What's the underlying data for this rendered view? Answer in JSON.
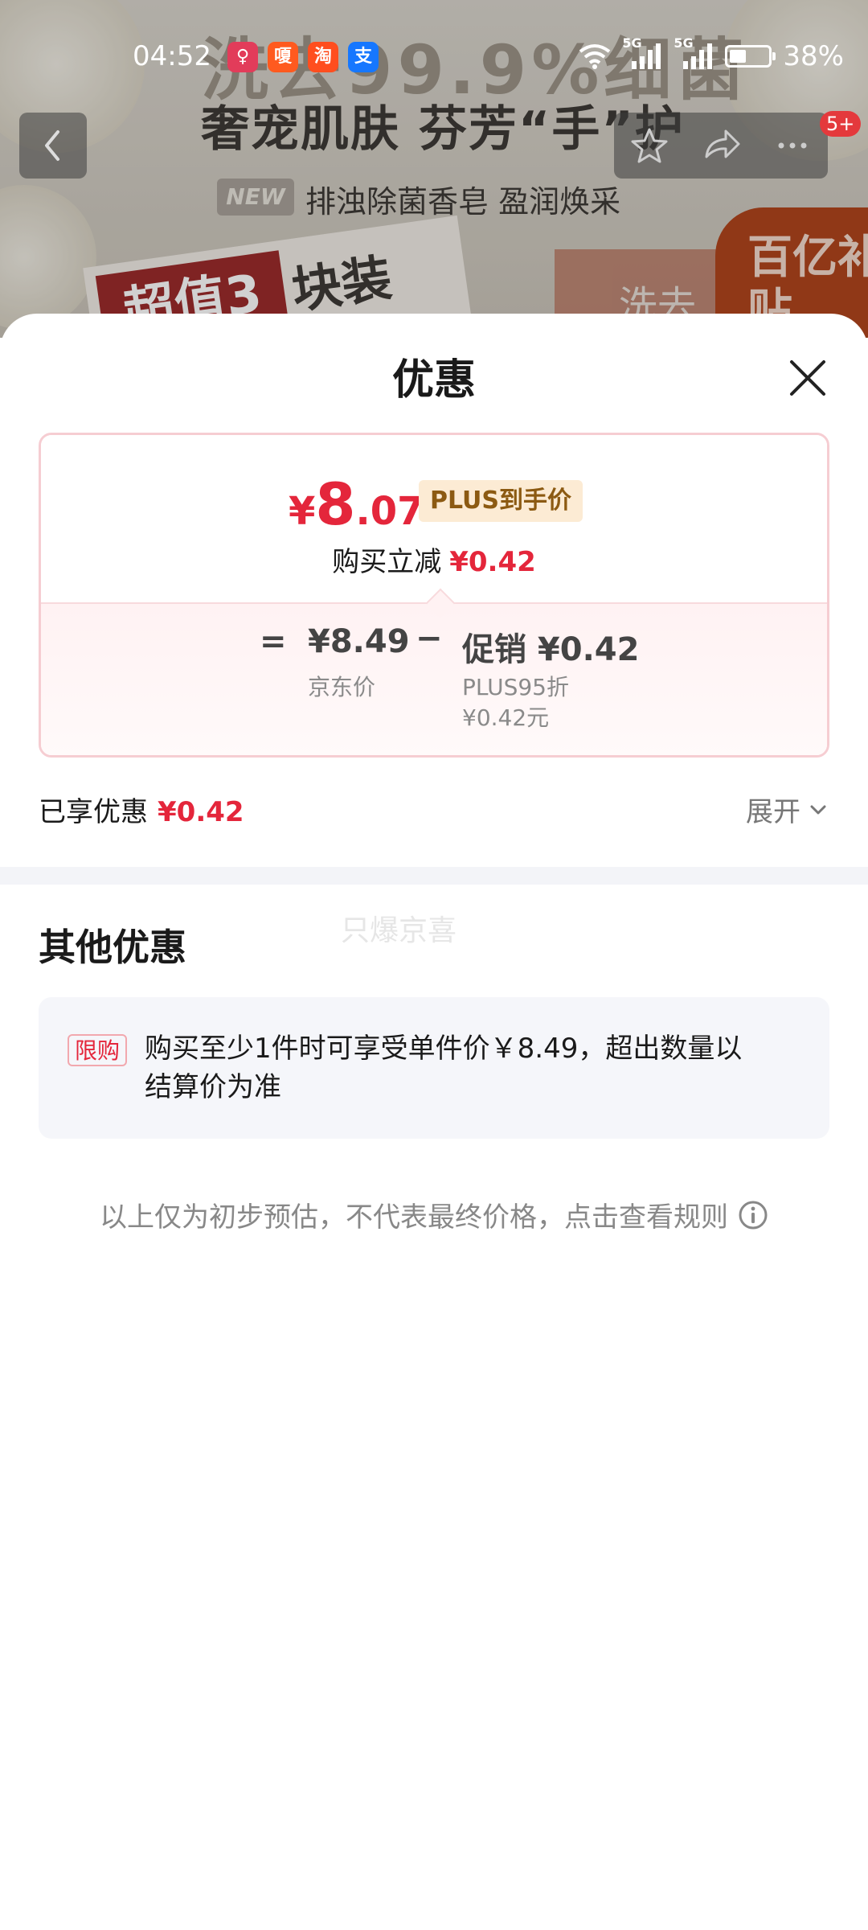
{
  "status_bar": {
    "time": "04:52",
    "app_icons": [
      {
        "name": "app-icon-1",
        "glyph": "♀",
        "color": "#e23c5a"
      },
      {
        "name": "app-icon-2",
        "glyph": "嗄",
        "color": "#ff5a1f"
      },
      {
        "name": "taobao-icon",
        "glyph": "淘",
        "color": "#ff4e1f"
      },
      {
        "name": "alipay-icon",
        "glyph": "支",
        "color": "#1677ff"
      }
    ],
    "signal1": "5G",
    "signal2": "5G",
    "battery": "38%"
  },
  "background": {
    "headline": "洗去99.9%细菌",
    "subheadline": "奢宠肌肤 芬芳“手”护",
    "new_tag": "NEW",
    "subline": "排浊除菌香皂 盈润焕采",
    "pack_red": "超值3",
    "pack_rest": "块装",
    "box_text": "洗去",
    "sticker": "百亿补贴"
  },
  "nav": {
    "badge": "5+"
  },
  "sheet": {
    "title": "优惠",
    "final_price": {
      "currency": "¥",
      "integer": "8",
      "decimal": ".07"
    },
    "plus_tag": "PLUS到手价",
    "reduce_label": "购买立减",
    "reduce_amount": "¥0.42",
    "breakdown": {
      "eq": "=",
      "base_price": "¥8.49",
      "base_label": "京东价",
      "minus": "−",
      "promo_price": "促销 ¥0.42",
      "promo_label": "PLUS95折",
      "promo_sub": "¥0.42元"
    },
    "enjoyed_label": "已享优惠",
    "enjoyed_amount": "¥0.42",
    "expand_label": "展开",
    "other_title": "其他优惠",
    "watermark": "只爆京喜",
    "limit_tag": "限购",
    "limit_text": "购买至少1件时可享受单件价￥8.49，超出数量以结算价为准",
    "disclaimer": "以上仅为初步预估，不代表最终价格，点击查看规则"
  }
}
